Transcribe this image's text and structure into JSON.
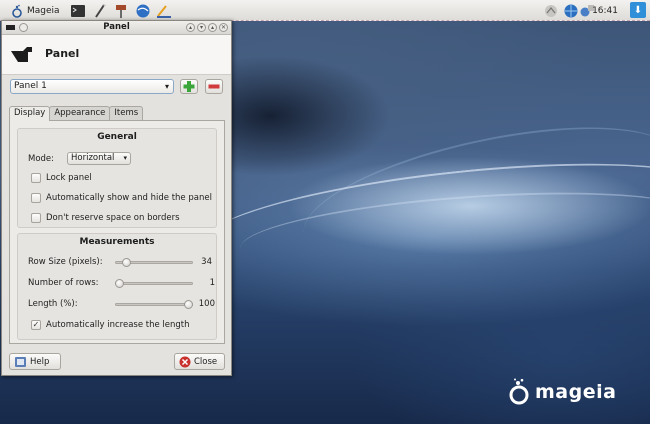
{
  "taskbar": {
    "menu_label": "Mageia",
    "launchers": [
      "terminal-icon",
      "text-editor-icon",
      "settings-icon",
      "browser-icon",
      "pen-icon"
    ],
    "clock": "16:41"
  },
  "window": {
    "title": "Panel",
    "header_title": "Panel",
    "panel_select": "Panel 1",
    "tabs": [
      {
        "label": "Display",
        "active": true
      },
      {
        "label": "Appearance",
        "active": false
      },
      {
        "label": "Items",
        "active": false
      }
    ],
    "general": {
      "title": "General",
      "mode_label": "Mode:",
      "mode_value": "Horizontal",
      "checkboxes": [
        {
          "label": "Lock panel",
          "checked": false
        },
        {
          "label": "Automatically show and hide the panel",
          "checked": false
        },
        {
          "label": "Don't reserve space on borders",
          "checked": false
        }
      ]
    },
    "measurements": {
      "title": "Measurements",
      "sliders": [
        {
          "label": "Row Size (pixels):",
          "value": "34",
          "fraction": 0.1
        },
        {
          "label": "Number of rows:",
          "value": "1",
          "fraction": 0.0
        },
        {
          "label": "Length (%):",
          "value": "100",
          "fraction": 1.0
        }
      ],
      "auto_length": {
        "label": "Automatically increase the length",
        "checked": true
      }
    },
    "help_label": "Help",
    "close_label": "Close"
  },
  "desktop": {
    "logo_text": "mageia"
  },
  "colors": {
    "add": "#3aa63a",
    "remove": "#d23b3b",
    "close_icon": "#c8312e"
  }
}
